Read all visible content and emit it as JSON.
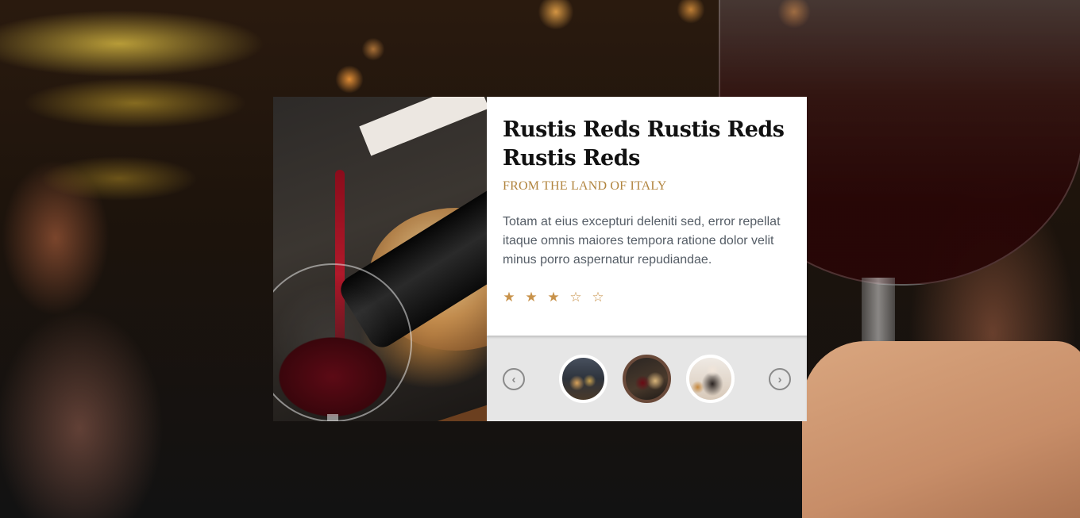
{
  "product": {
    "title": "Rustis Reds Rustis Reds Rustis Reds",
    "subtitle": "FROM THE LAND OF ITALY",
    "description": "Totam at eius excepturi deleniti sed, error repellat itaque omnis maiores tempora ratione dolor velit minus porro aspernatur repudiandae.",
    "rating": 3,
    "rating_max": 5,
    "stars": [
      "★",
      "★",
      "★",
      "☆",
      "☆"
    ]
  },
  "carousel": {
    "prev_icon": "chevron-left-icon",
    "next_icon": "chevron-right-icon",
    "prev_glyph": "‹",
    "next_glyph": "›",
    "active_index": 1,
    "thumbnails": [
      "food-plates-thumbnail",
      "wine-pour-thumbnail",
      "coffee-cup-thumbnail"
    ]
  },
  "colors": {
    "accent": "#b1843e",
    "star": "#c8924a",
    "nav_background": "#e6e6e6",
    "card_background": "#ffffff",
    "active_thumb_border": "#6a4a3a"
  }
}
